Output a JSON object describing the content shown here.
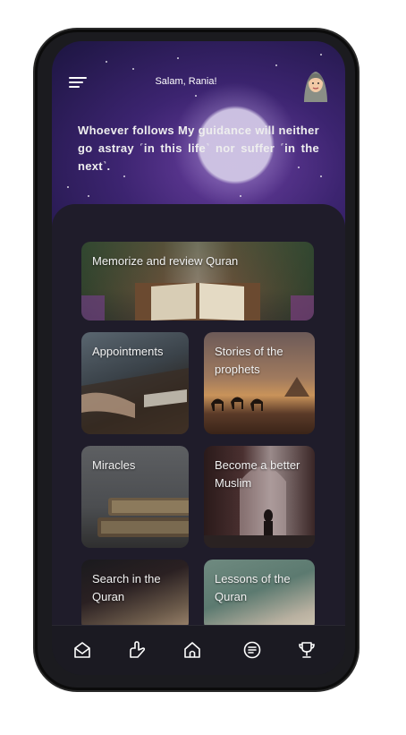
{
  "header": {
    "greeting": "Salam, Rania!"
  },
  "quote": "Whoever follows My guidance will neither go astray ˹in this life˺ nor suffer ˹in the next˺.",
  "cards": [
    {
      "label": "Memorize and review Quran"
    },
    {
      "label": "Appointments"
    },
    {
      "label": "Stories of the prophets"
    },
    {
      "label": "Miracles"
    },
    {
      "label": "Become a better Muslim"
    },
    {
      "label": "Search in the Quran"
    },
    {
      "label": "Lessons of the Quran"
    }
  ],
  "nav": {
    "items": [
      {
        "icon": "read-icon"
      },
      {
        "icon": "hands-icon"
      },
      {
        "icon": "home-icon"
      },
      {
        "icon": "list-icon"
      },
      {
        "icon": "trophy-icon"
      }
    ]
  }
}
